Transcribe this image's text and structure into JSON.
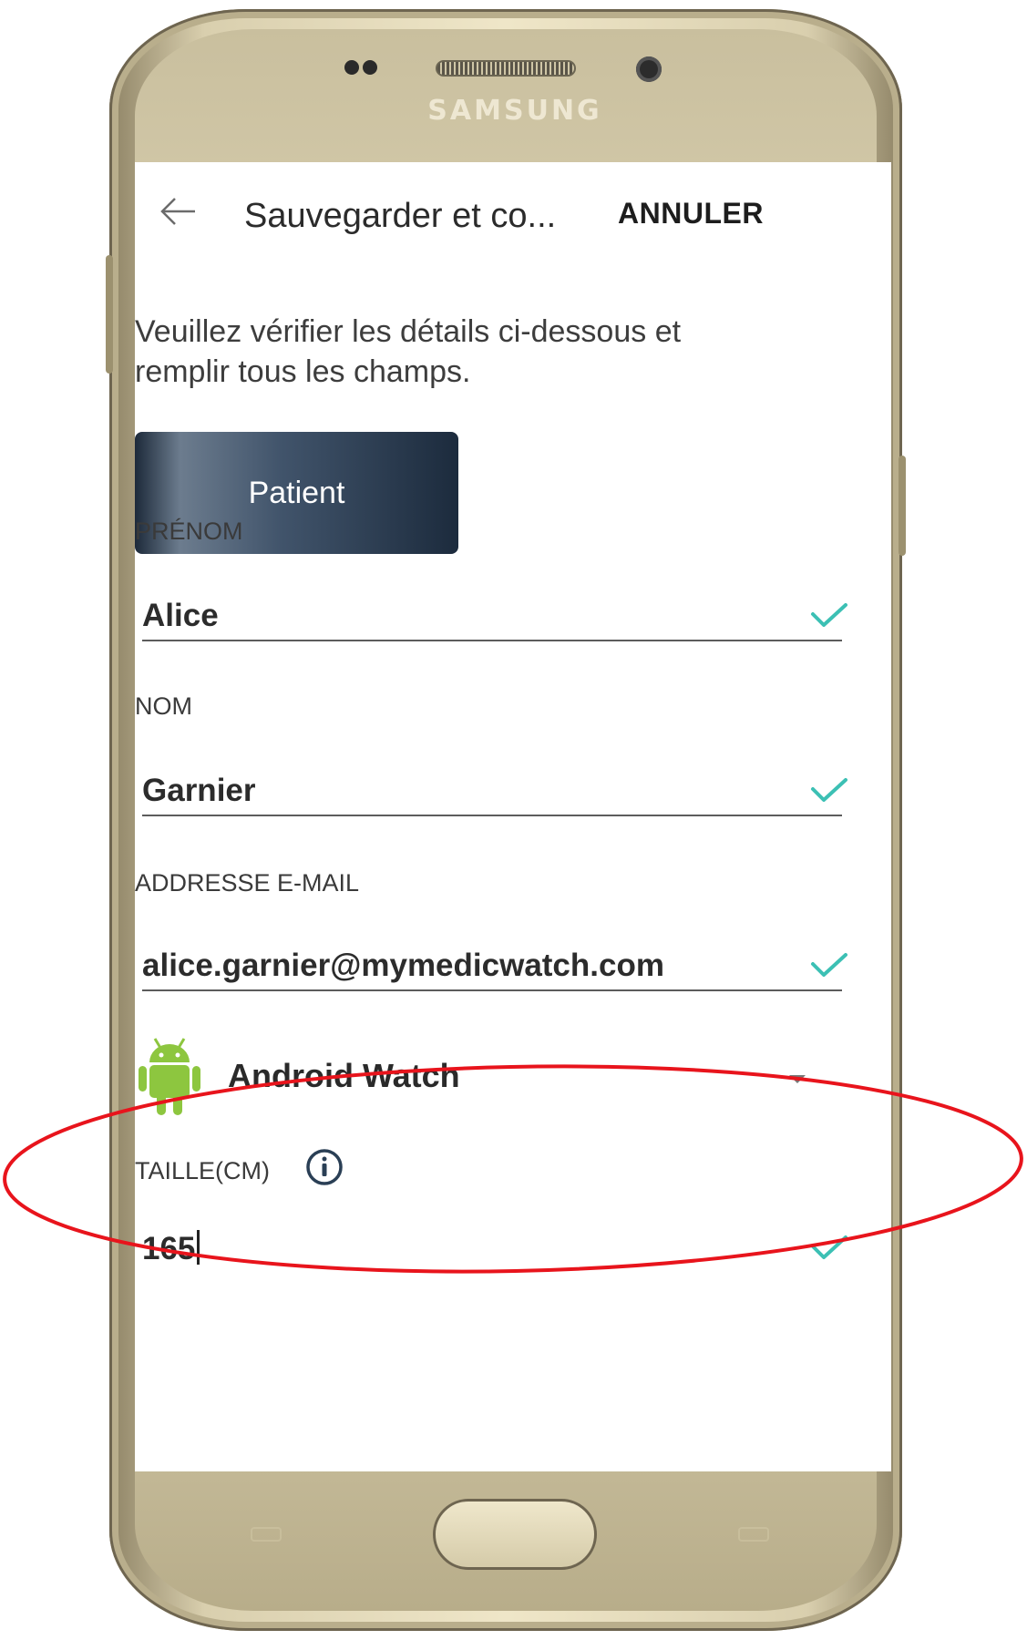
{
  "device": {
    "brand_logo": "SAMSUNG"
  },
  "app_bar": {
    "back_icon": "arrow-left-icon",
    "title": "Sauvegarder et co...",
    "cancel_label": "ANNULER"
  },
  "intro": {
    "line1": "Veuillez vérifier les détails ci-dessous et",
    "line2": "remplir tous les champs."
  },
  "role_button": {
    "label": "Patient"
  },
  "fields": {
    "first_name": {
      "label": "PRÉNOM",
      "value": "Alice",
      "status_icon": "check-icon"
    },
    "last_name": {
      "label": "NOM",
      "value": "Garnier",
      "status_icon": "check-icon"
    },
    "email": {
      "label": "ADDRESSE E-MAIL",
      "value": "alice.garnier@mymedicwatch.com",
      "status_icon": "check-icon"
    },
    "height": {
      "label": "TAILLE(CM)",
      "value": "165",
      "info_icon": "info-icon",
      "status_icon": "check-icon"
    }
  },
  "device_select": {
    "icon": "android-icon",
    "selected": "Android Watch",
    "caret_icon": "caret-down-icon"
  },
  "colors": {
    "check": "#3cc0b4",
    "android_green": "#8dc63f",
    "role_button_dark": "#1d2a3a",
    "annotation": "#e8141c"
  }
}
